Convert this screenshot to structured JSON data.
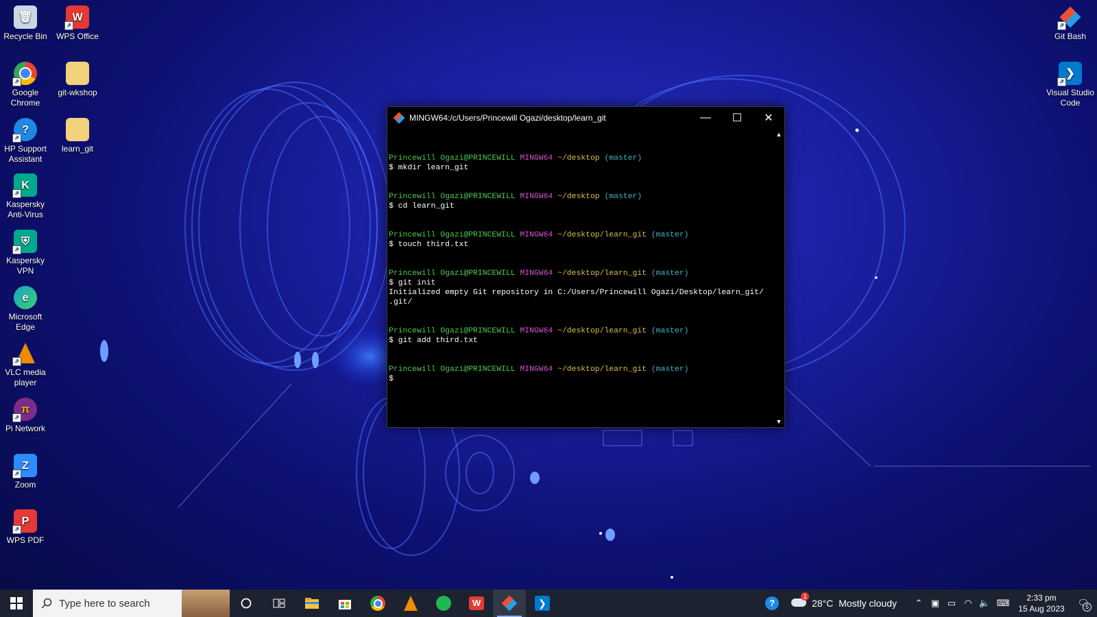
{
  "desktop_icons_left": [
    {
      "label": "Recycle Bin",
      "icon": "recycle-bin-icon",
      "color": "#c9d6e6"
    },
    {
      "label": "WPS Office",
      "icon": "wps-office-icon",
      "color": "#e53935"
    },
    {
      "label": "Google Chrome",
      "icon": "chrome-icon",
      "color": "#4285f4"
    },
    {
      "label": "git-wkshop",
      "icon": "folder-icon",
      "color": "#f2d27a"
    },
    {
      "label": "HP Support Assistant",
      "icon": "hp-support-icon",
      "color": "#1e88e5"
    },
    {
      "label": "learn_git",
      "icon": "folder-icon",
      "color": "#f2d27a"
    },
    {
      "label": "Kaspersky Anti-Virus",
      "icon": "kaspersky-antivirus-icon",
      "color": "#00a88e"
    },
    {
      "label": "Kaspersky VPN",
      "icon": "kaspersky-vpn-icon",
      "color": "#00a88e"
    },
    {
      "label": "Microsoft Edge",
      "icon": "edge-icon",
      "color": "#1ba1c7"
    },
    {
      "label": "VLC media player",
      "icon": "vlc-icon",
      "color": "#f08a00"
    },
    {
      "label": "Pi Network",
      "icon": "pi-network-icon",
      "color": "#7b2c8c"
    },
    {
      "label": "Zoom",
      "icon": "zoom-icon",
      "color": "#2d8cff"
    },
    {
      "label": "WPS PDF",
      "icon": "wps-pdf-icon",
      "color": "#e53935"
    }
  ],
  "desktop_icons_right": [
    {
      "label": "Git Bash",
      "icon": "git-bash-icon",
      "color": "#f05032"
    },
    {
      "label": "Visual Studio Code",
      "icon": "vscode-icon",
      "color": "#007acc"
    }
  ],
  "terminal": {
    "title": "MINGW64:/c/Users/Princewill Ogazi/desktop/learn_git",
    "user": "Princewill Ogazi@PRINCEWILL",
    "shell": "MINGW64",
    "branch": "(master)",
    "blocks": [
      {
        "path": "~/desktop",
        "command": "$ mkdir learn_git",
        "output": ""
      },
      {
        "path": "~/desktop",
        "command": "$ cd learn_git",
        "output": ""
      },
      {
        "path": "~/desktop/learn_git",
        "command": "$ touch third.txt",
        "output": ""
      },
      {
        "path": "~/desktop/learn_git",
        "command": "$ git init",
        "output": "Initialized empty Git repository in C:/Users/Princewill Ogazi/Desktop/learn_git/\n.git/"
      },
      {
        "path": "~/desktop/learn_git",
        "command": "$ git add third.txt",
        "output": ""
      },
      {
        "path": "~/desktop/learn_git",
        "command": "$",
        "output": ""
      }
    ],
    "minimize_label": "—",
    "maximize_label": "☐",
    "close_label": "✕"
  },
  "taskbar": {
    "search_placeholder": "Type here to search",
    "pinned": [
      {
        "icon": "cortana-icon"
      },
      {
        "icon": "task-view-icon"
      },
      {
        "icon": "file-explorer-icon"
      },
      {
        "icon": "microsoft-store-icon"
      },
      {
        "icon": "chrome-icon"
      },
      {
        "icon": "vlc-icon"
      },
      {
        "icon": "spotify-icon"
      },
      {
        "icon": "wps-office-icon"
      },
      {
        "icon": "git-bash-icon"
      },
      {
        "icon": "vscode-icon"
      }
    ],
    "weather_temp": "28°C",
    "weather_desc": "Mostly cloudy",
    "weather_badge": "1",
    "time": "2:33 pm",
    "date": "15 Aug 2023",
    "notification_count": "5"
  }
}
